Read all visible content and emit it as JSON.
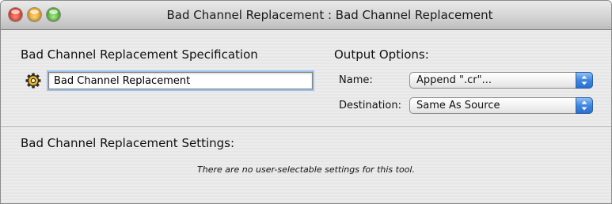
{
  "window": {
    "title": "Bad Channel Replacement : Bad Channel Replacement"
  },
  "specification": {
    "heading": "Bad Channel Replacement Specification",
    "input_value": "Bad Channel Replacement",
    "icon": "gear-icon"
  },
  "output_options": {
    "heading": "Output Options:",
    "name_label": "Name:",
    "name_value": "Append \".cr\"...",
    "destination_label": "Destination:",
    "destination_value": "Same As Source"
  },
  "settings": {
    "heading": "Bad Channel Replacement Settings:",
    "message": "There are no user-selectable settings for this tool."
  },
  "colors": {
    "close": "#d8321f",
    "minimize": "#e69a14",
    "zoom": "#4aa62b",
    "popup_accent": "#3f86df",
    "focus_ring": "#9ec0ef"
  }
}
